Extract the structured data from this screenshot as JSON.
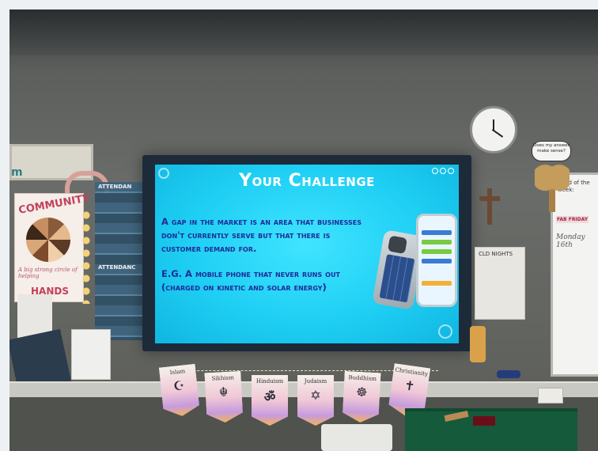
{
  "slide": {
    "title": "Your Challenge",
    "paragraph1": "A gap in the market is an area that businesses don't currently serve but that there is customer demand for.",
    "paragraph2": "E.G. A mobile phone that never runs out (charged on kinetic and solar energy)"
  },
  "left_poster": {
    "title": "COMMUNITY",
    "subtitle": "A big strong circle of helping",
    "footer": "HANDS"
  },
  "attendance": {
    "label1": "ATTENDAN",
    "label2": "ATTENDANC"
  },
  "wall_letters": "m",
  "right_board": {
    "heading": "Word of the week:",
    "tag": "FAB FRIDAY",
    "day": "Monday 16th"
  },
  "speech_bubble": "Does my answer make sense?",
  "notice_title": "CLD NIGHTS",
  "bunting": [
    {
      "label": "Islam",
      "symbol": "☪"
    },
    {
      "label": "Sikhism",
      "symbol": "☬"
    },
    {
      "label": "Hinduism",
      "symbol": "ॐ"
    },
    {
      "label": "Judaism",
      "symbol": "✡"
    },
    {
      "label": "Buddhism",
      "symbol": "☸"
    },
    {
      "label": "Christianity",
      "symbol": "✝"
    }
  ],
  "colors": {
    "screen_bg": "#1fcff4",
    "title_text": "#ffffff",
    "body_text": "#1d2c98",
    "table": "#155a3a"
  }
}
